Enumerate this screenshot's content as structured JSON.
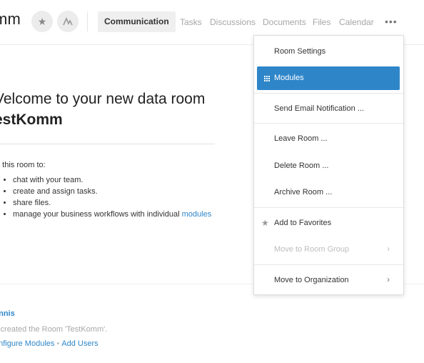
{
  "header": {
    "room_title_partial": "mm",
    "favorite_icon": "star-icon",
    "activity_icon": "activity-icon",
    "tabs": [
      {
        "label": "Communication",
        "active": true
      },
      {
        "label": "Tasks"
      },
      {
        "label": "Discussions"
      },
      {
        "label": "Documents"
      },
      {
        "label": "Files"
      },
      {
        "label": "Calendar"
      }
    ],
    "more_label": "•••"
  },
  "main": {
    "welcome_line": "Velcome to your new data room",
    "room_name": "estKomm",
    "intro_text": "e this room to:",
    "bullets": [
      "chat with your team.",
      "create and assign tasks.",
      "share files.",
      "manage your business workflows with individual"
    ],
    "modules_link": "modules"
  },
  "activity": {
    "user": "ennis",
    "message": "s created the Room 'TestKomm'.",
    "link_configure": "onfigure Modules",
    "separator": "•",
    "link_add_users": "Add Users"
  },
  "menu": {
    "items": [
      {
        "label": "Room Settings"
      },
      {
        "label": "Modules",
        "active": true,
        "icon": "grid-icon"
      },
      {
        "label": "Send Email Notification ..."
      },
      {
        "label": "Leave Room ..."
      },
      {
        "label": "Delete Room ..."
      },
      {
        "label": "Archive Room ..."
      },
      {
        "label": "Add to Favorites",
        "icon": "star-icon"
      },
      {
        "label": "Move to Room Group",
        "disabled": true,
        "submenu": true
      },
      {
        "label": "Move to Organization",
        "submenu": true
      }
    ],
    "chevron": "›",
    "star_glyph": "★"
  },
  "colors": {
    "accent": "#2e86c9",
    "tab_active_bg": "#efefef"
  }
}
